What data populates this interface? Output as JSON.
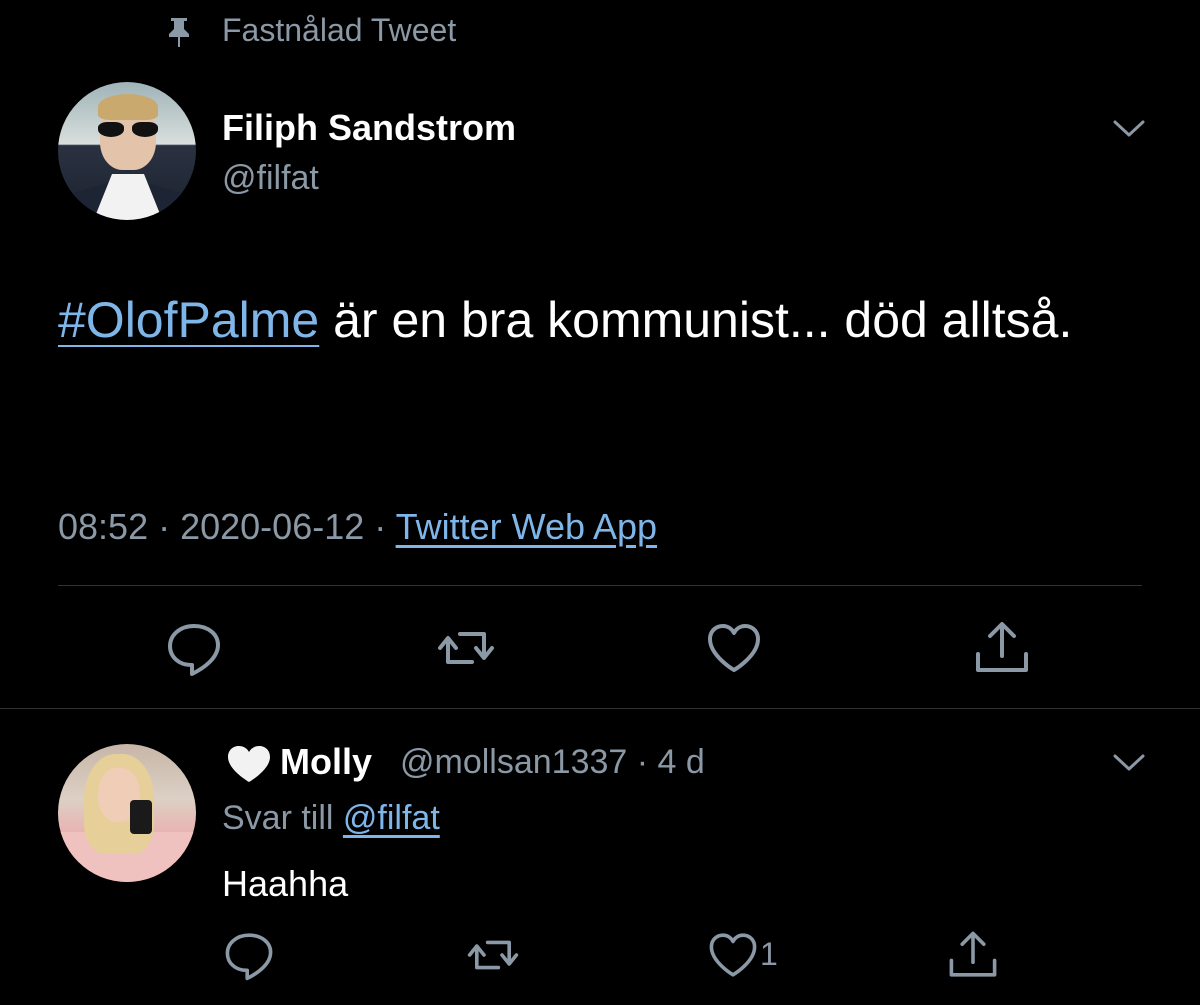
{
  "pinned": {
    "label": "Fastnålad Tweet"
  },
  "tweet": {
    "author_name": "Filiph Sandstrom",
    "author_handle": "@filfat",
    "hashtag": "#OlofPalme",
    "text_rest": " är en bra kommunist... död alltså.",
    "time": "08:52",
    "separator1": " · ",
    "date": "2020-06-12",
    "separator2": " · ",
    "source": "Twitter Web App",
    "icons": [
      "reply-icon",
      "retweet-icon",
      "like-icon",
      "share-icon"
    ]
  },
  "reply": {
    "name_emoji": "heart-icon",
    "author_name": "Molly",
    "author_handle": "@mollsan1337 · 4 d",
    "reply_to_label": "Svar till ",
    "reply_to_handle": "@filfat",
    "text": "Haahha",
    "like_count": "1"
  },
  "colors": {
    "background": "#000000",
    "secondary_text": "#8b98a5",
    "link": "#7fb6ea",
    "divider": "#2f3336"
  }
}
